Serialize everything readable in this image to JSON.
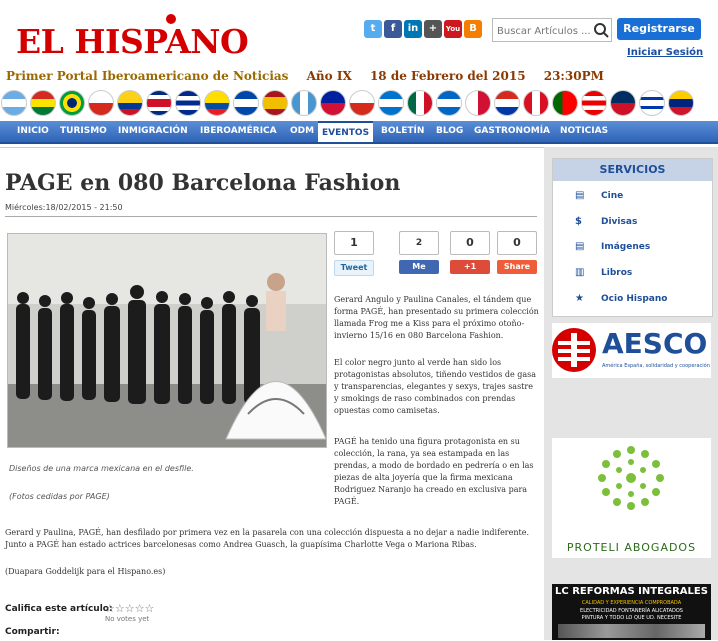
{
  "header": {
    "logo": "EL HISPANO",
    "search_placeholder": "Buscar Artículos ...",
    "register": "Registrarse",
    "login": "Iniciar Sesión",
    "tagline": "Primer Portal Iberoamericano de Noticias",
    "year": "Año IX",
    "date": "18 de Febrero del 2015",
    "time": "23:30PM",
    "social": [
      "twitter",
      "facebook",
      "linkedin",
      "google-plus",
      "youtube",
      "blogger"
    ]
  },
  "nav": {
    "items": [
      "INICIO",
      "TURISMO",
      "INMIGRACIÓN",
      "IBEROAMÉRICA",
      "ODM",
      "EVENTOS",
      "BOLETÍN",
      "BLOG",
      "GASTRONOMÍA",
      "NOTICIAS"
    ],
    "active": "EVENTOS"
  },
  "article": {
    "title": "PAGE en 080 Barcelona Fashion",
    "meta": "Miércoles:18/02/2015 - 21:50",
    "caption1": "Diseños de una marca mexicana en el desfile.",
    "caption2": "(Fotos cedidas por PAGE)",
    "p1": "Gerard Angulo y Paulina Canales, el tándem que forma PAGÉ, han presentado su primera colección llamada Frog me a Kiss  para el próximo otoño-invierno 15/16 en 080 Barcelona Fashion.",
    "p2": "El color negro junto al verde han sido los protagonistas absolutos, tiñendo vestidos de gasa y transparencias, elegantes y sexys, trajes sastre y smokings de raso combinados con prendas opuestas como camisetas.",
    "p3": "PAGÉ ha tenido una figura protagonista en su colección, la rana, ya sea estampada en las prendas, a modo de bordado en pedrería o en las piezas de alta joyería que la firma mexicana Rodriguez Naranjo ha creado en exclusiva para PAGÉ.",
    "p4": "Gerard y Paulina, PAGÉ, han desfilado por primera vez en la pasarela con una colección dispuesta a no dejar a nadie indiferente. Junto a PAGÉ han estado actrices barcelonesas como Andrea Guasch, la guapísima Charlotte Vega o Mariona Ribas.",
    "p5": "(Duapara Goddelijk para el Hispano.es)",
    "rate_label": "Califica este artículo:",
    "no_votes": "No votes yet",
    "share_label": "Compartir:"
  },
  "share": {
    "tweet_count": "1",
    "tweet": "Tweet",
    "like_count": "2",
    "like": "Me gusta",
    "gplus_count": "0",
    "gplus": "+1",
    "share_count": "0",
    "share": "Share"
  },
  "sidebar": {
    "services_title": "SERVICIOS",
    "services": [
      {
        "icon": "film-icon",
        "label": "Cine"
      },
      {
        "icon": "dollar-icon",
        "label": "Divisas"
      },
      {
        "icon": "images-icon",
        "label": "Imágenes"
      },
      {
        "icon": "books-icon",
        "label": "Libros"
      },
      {
        "icon": "star-icon",
        "label": "Ocio Hispano"
      }
    ],
    "ad1_title": "AESCO",
    "ad1_sub": "América España, solidaridad y cooperación",
    "ad2_title": "PROTELI ABOGADOS",
    "ad3_title": "LC REFORMAS INTEGRALES",
    "ad3_sub1": "CALIDAD Y EXPERIENCIA COMPROBADA",
    "ad3_sub2": "ELECTRICIDAD  FONTANERÍA  ALICATADOS",
    "ad3_sub3": "PINTURA Y TODO LO QUE UD. NECESITE"
  },
  "colors": {
    "logo_red": "#d40000",
    "nav_blue": "#2f64b8",
    "link_blue": "#1a4ea0",
    "tagline_gold": "#9a6a00"
  }
}
